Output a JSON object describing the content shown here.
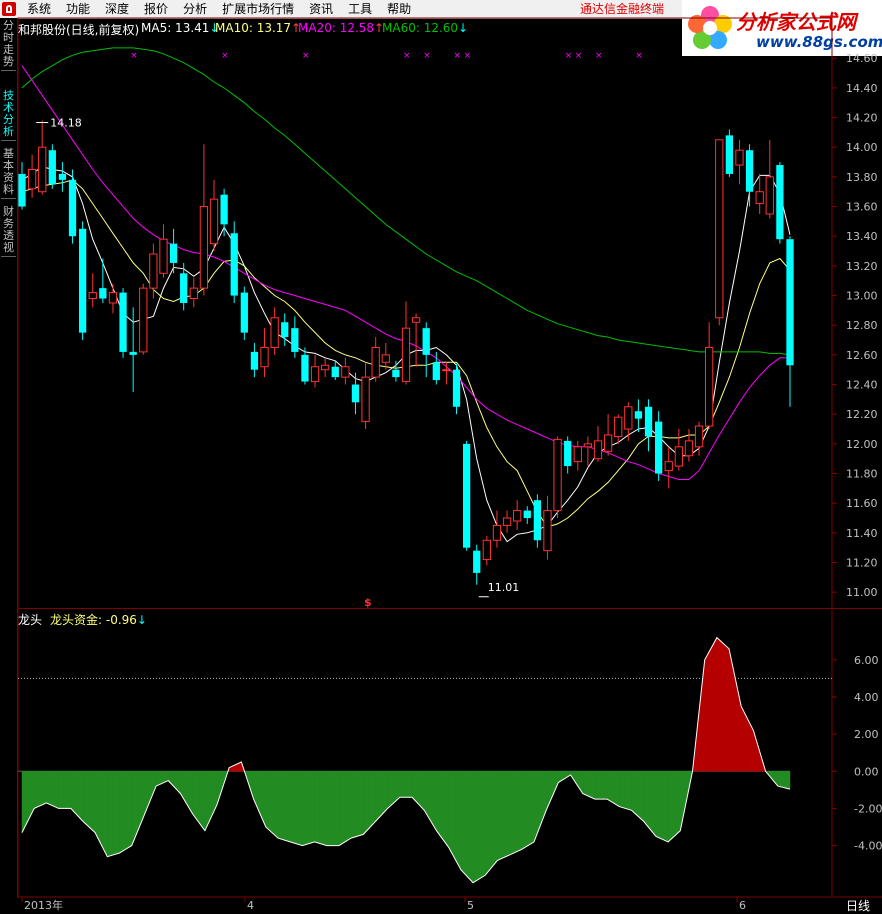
{
  "menu": [
    "系统",
    "功能",
    "深度",
    "报价",
    "分析",
    "扩展市场行情",
    "资讯",
    "工具",
    "帮助"
  ],
  "promo_text": "通达信金融终端",
  "watermark": {
    "title": "分析家公式网",
    "url": "www.88gs.com"
  },
  "side_tabs": [
    "分时走势",
    "技术分析",
    "基本资料",
    "财务透视"
  ],
  "header": {
    "stock": "和邦股份(日线,前复权)",
    "ma5": "MA5: 13.41",
    "ma10": "MA10: 13.17",
    "ma20": "MA20: 12.58",
    "ma60": "MA60: 12.60",
    "ma5_arrow": "↓",
    "ma10_arrow": "↑",
    "ma20_arrow": "↑",
    "ma60_arrow": "↓"
  },
  "indicator_header": {
    "name": "龙头",
    "label": "龙头资金: -0.96",
    "arrow": "↓"
  },
  "bottom": {
    "period": "日线"
  },
  "colors": {
    "up": "#ff3232",
    "down": "#00ffff",
    "ma5": "#ffffff",
    "ma10": "#ffff80",
    "ma20": "#ff00ff",
    "ma60": "#00c000",
    "pos_fill": "#b40000",
    "neg_fill": "#228b22",
    "frame": "#800000"
  },
  "chart_data": [
    {
      "type": "candlestick",
      "title": "和邦股份(日线,前复权)",
      "ylim": [
        10.9,
        14.75
      ],
      "y_ticks": [
        "14.60",
        "14.40",
        "14.20",
        "14.00",
        "13.80",
        "13.60",
        "13.40",
        "13.20",
        "13.00",
        "12.80",
        "12.60",
        "12.40",
        "12.20",
        "12.00",
        "11.80",
        "11.60",
        "11.40",
        "11.20",
        "11.00"
      ],
      "x_labels": [
        "2013年",
        "4",
        "5",
        "6"
      ],
      "annotations": {
        "high": "14.18",
        "low": "11.01",
        "marker": "$"
      },
      "candles": [
        [
          13.82,
          13.6,
          13.9,
          13.58
        ],
        [
          13.72,
          13.85,
          13.95,
          13.66
        ],
        [
          13.7,
          14.0,
          14.18,
          13.68
        ],
        [
          13.98,
          13.75,
          14.02,
          13.72
        ],
        [
          13.82,
          13.78,
          13.9,
          13.7
        ],
        [
          13.78,
          13.4,
          13.85,
          13.35
        ],
        [
          13.45,
          12.75,
          13.5,
          12.7
        ],
        [
          12.98,
          13.02,
          13.15,
          12.92
        ],
        [
          13.05,
          12.98,
          13.25,
          12.95
        ],
        [
          12.95,
          13.02,
          13.08,
          12.88
        ],
        [
          13.02,
          12.62,
          13.05,
          12.58
        ],
        [
          12.62,
          12.6,
          12.92,
          12.35
        ],
        [
          12.62,
          13.05,
          13.08,
          12.6
        ],
        [
          13.05,
          13.28,
          13.35,
          12.98
        ],
        [
          13.15,
          13.38,
          13.48,
          13.12
        ],
        [
          13.35,
          13.22,
          13.45,
          13.15
        ],
        [
          13.15,
          12.95,
          13.22,
          12.9
        ],
        [
          12.98,
          13.05,
          13.12,
          12.92
        ],
        [
          13.05,
          13.6,
          14.02,
          13.0
        ],
        [
          13.35,
          13.65,
          13.78,
          13.3
        ],
        [
          13.68,
          13.48,
          13.72,
          13.4
        ],
        [
          13.42,
          13.0,
          13.5,
          12.95
        ],
        [
          13.02,
          12.75,
          13.06,
          12.7
        ],
        [
          12.62,
          12.5,
          12.68,
          12.45
        ],
        [
          12.52,
          12.65,
          12.78,
          12.45
        ],
        [
          12.65,
          12.85,
          12.92,
          12.6
        ],
        [
          12.82,
          12.72,
          12.88,
          12.66
        ],
        [
          12.78,
          12.62,
          12.86,
          12.58
        ],
        [
          12.6,
          12.42,
          12.65,
          12.4
        ],
        [
          12.42,
          12.52,
          12.6,
          12.38
        ],
        [
          12.5,
          12.53,
          12.58,
          12.45
        ],
        [
          12.52,
          12.45,
          12.56,
          12.43
        ],
        [
          12.45,
          12.52,
          12.58,
          12.4
        ],
        [
          12.4,
          12.28,
          12.48,
          12.2
        ],
        [
          12.15,
          12.45,
          12.55,
          12.1
        ],
        [
          12.45,
          12.65,
          12.72,
          12.42
        ],
        [
          12.55,
          12.6,
          12.68,
          12.5
        ],
        [
          12.5,
          12.45,
          12.56,
          12.42
        ],
        [
          12.42,
          12.78,
          12.96,
          12.4
        ],
        [
          12.82,
          12.85,
          12.88,
          12.52
        ],
        [
          12.78,
          12.6,
          12.82,
          12.45
        ],
        [
          12.55,
          12.43,
          12.62,
          12.4
        ],
        [
          12.5,
          12.5,
          12.55,
          12.4
        ],
        [
          12.5,
          12.25,
          12.54,
          12.2
        ],
        [
          12.0,
          11.3,
          12.02,
          11.28
        ],
        [
          11.28,
          11.13,
          11.32,
          11.05
        ],
        [
          11.22,
          11.35,
          11.38,
          11.18
        ],
        [
          11.35,
          11.45,
          11.55,
          11.3
        ],
        [
          11.45,
          11.5,
          11.55,
          11.4
        ],
        [
          11.48,
          11.55,
          11.62,
          11.42
        ],
        [
          11.55,
          11.5,
          11.58,
          11.46
        ],
        [
          11.62,
          11.35,
          11.66,
          11.3
        ],
        [
          11.28,
          11.55,
          11.65,
          11.22
        ],
        [
          11.55,
          12.03,
          12.05,
          11.5
        ],
        [
          12.02,
          11.85,
          12.05,
          11.8
        ],
        [
          11.88,
          11.98,
          12.02,
          11.82
        ],
        [
          11.98,
          12.0,
          12.05,
          11.85
        ],
        [
          11.9,
          12.02,
          12.12,
          11.88
        ],
        [
          11.95,
          12.06,
          12.2,
          11.92
        ],
        [
          12.05,
          12.18,
          12.2,
          12.0
        ],
        [
          12.1,
          12.25,
          12.28,
          12.02
        ],
        [
          12.22,
          12.17,
          12.3,
          12.08
        ],
        [
          12.25,
          12.05,
          12.3,
          11.95
        ],
        [
          12.15,
          11.8,
          12.22,
          11.75
        ],
        [
          11.82,
          11.88,
          11.98,
          11.7
        ],
        [
          11.85,
          11.98,
          12.1,
          11.82
        ],
        [
          11.92,
          12.02,
          12.1,
          11.88
        ],
        [
          11.98,
          12.12,
          12.15,
          11.92
        ],
        [
          12.12,
          12.65,
          12.82,
          12.1
        ],
        [
          12.85,
          14.05,
          14.05,
          12.8
        ],
        [
          14.08,
          13.82,
          14.12,
          13.8
        ],
        [
          13.88,
          13.98,
          14.05,
          13.75
        ],
        [
          13.98,
          13.7,
          14.02,
          13.6
        ],
        [
          13.62,
          13.7,
          13.82,
          13.55
        ],
        [
          13.55,
          13.8,
          14.05,
          13.52
        ],
        [
          13.88,
          13.38,
          13.9,
          13.35
        ],
        [
          13.38,
          12.53,
          13.4,
          12.25
        ]
      ],
      "series": [
        {
          "name": "MA5",
          "values": [
            13.78,
            13.82,
            13.87,
            13.85,
            13.84,
            13.8,
            13.62,
            13.38,
            13.22,
            13.05,
            12.88,
            12.82,
            12.84,
            12.86,
            13.05,
            13.19,
            13.18,
            13.13,
            13.18,
            13.32,
            13.46,
            13.35,
            13.2,
            13.02,
            12.88,
            12.75,
            12.71,
            12.66,
            12.62,
            12.61,
            12.58,
            12.56,
            12.5,
            12.44,
            12.42,
            12.45,
            12.48,
            12.53,
            12.6,
            12.63,
            12.63,
            12.65,
            12.6,
            12.53,
            12.3,
            11.9,
            11.62,
            11.45,
            11.34,
            11.39,
            11.4,
            11.42,
            11.45,
            11.54,
            11.62,
            11.71,
            11.84,
            11.94,
            11.98,
            12.01,
            12.06,
            12.1,
            12.11,
            12.05,
            11.98,
            11.92,
            11.92,
            11.97,
            12.12,
            12.55,
            12.95,
            13.3,
            13.7,
            13.81,
            13.81,
            13.69,
            13.41
          ]
        },
        {
          "name": "MA10",
          "values": [
            13.7,
            13.72,
            13.74,
            13.75,
            13.76,
            13.78,
            13.72,
            13.62,
            13.52,
            13.42,
            13.32,
            13.22,
            13.15,
            13.04,
            12.98,
            12.96,
            12.99,
            13.0,
            13.05,
            13.15,
            13.23,
            13.24,
            13.2,
            13.12,
            13.06,
            13.0,
            12.96,
            12.9,
            12.82,
            12.75,
            12.68,
            12.63,
            12.6,
            12.58,
            12.55,
            12.53,
            12.52,
            12.51,
            12.52,
            12.53,
            12.53,
            12.55,
            12.55,
            12.55,
            12.46,
            12.28,
            12.11,
            11.98,
            11.88,
            11.82,
            11.68,
            11.54,
            11.44,
            11.46,
            11.5,
            11.56,
            11.63,
            11.68,
            11.74,
            11.82,
            11.9,
            12.0,
            12.05,
            12.05,
            12.04,
            12.04,
            12.06,
            12.06,
            12.12,
            12.28,
            12.45,
            12.65,
            12.88,
            13.08,
            13.22,
            13.25,
            13.17
          ]
        },
        {
          "name": "MA20",
          "values": [
            14.55,
            14.45,
            14.35,
            14.25,
            14.15,
            14.05,
            13.95,
            13.85,
            13.76,
            13.68,
            13.6,
            13.52,
            13.46,
            13.41,
            13.37,
            13.34,
            13.31,
            13.29,
            13.28,
            13.26,
            13.23,
            13.19,
            13.15,
            13.11,
            13.07,
            13.04,
            13.02,
            13.0,
            12.98,
            12.96,
            12.94,
            12.92,
            12.9,
            12.86,
            12.82,
            12.78,
            12.74,
            12.71,
            12.69,
            12.66,
            12.62,
            12.58,
            12.52,
            12.46,
            12.38,
            12.3,
            12.24,
            12.2,
            12.16,
            12.13,
            12.1,
            12.07,
            12.04,
            12.01,
            11.99,
            11.98,
            11.98,
            11.96,
            11.94,
            11.91,
            11.88,
            11.86,
            11.83,
            11.8,
            11.78,
            11.76,
            11.76,
            11.82,
            11.94,
            12.06,
            12.17,
            12.28,
            12.38,
            12.46,
            12.53,
            12.58,
            12.58
          ]
        },
        {
          "name": "MA60",
          "values": [
            14.4,
            14.46,
            14.51,
            14.55,
            14.59,
            14.62,
            14.64,
            14.65,
            14.66,
            14.67,
            14.67,
            14.67,
            14.66,
            14.65,
            14.63,
            14.6,
            14.57,
            14.53,
            14.49,
            14.44,
            14.4,
            14.35,
            14.3,
            14.24,
            14.19,
            14.13,
            14.08,
            14.02,
            13.96,
            13.9,
            13.84,
            13.78,
            13.72,
            13.66,
            13.6,
            13.54,
            13.48,
            13.43,
            13.38,
            13.33,
            13.28,
            13.24,
            13.2,
            13.16,
            13.13,
            13.1,
            13.06,
            13.02,
            12.98,
            12.94,
            12.9,
            12.87,
            12.84,
            12.81,
            12.79,
            12.77,
            12.75,
            12.73,
            12.72,
            12.7,
            12.69,
            12.68,
            12.67,
            12.66,
            12.65,
            12.64,
            12.63,
            12.62,
            12.62,
            12.62,
            12.62,
            12.62,
            12.62,
            12.62,
            12.61,
            12.61,
            12.6
          ]
        }
      ],
      "signal_markers": [
        11,
        20,
        28,
        38,
        40,
        43,
        44,
        54,
        55,
        57,
        61
      ]
    },
    {
      "type": "area",
      "title": "龙头资金",
      "ylim": [
        -6.5,
        7.5
      ],
      "y_ticks": [
        "6.00",
        "4.00",
        "2.00",
        "0.00",
        "-2.00",
        "-4.00"
      ],
      "dotted_level": 5.0,
      "values": [
        -3.3,
        -2.0,
        -1.7,
        -2.0,
        -2.0,
        -2.7,
        -3.3,
        -4.6,
        -4.4,
        -4.0,
        -2.4,
        -0.8,
        -0.5,
        -1.2,
        -2.3,
        -3.2,
        -1.8,
        0.2,
        0.5,
        -1.5,
        -3.0,
        -3.6,
        -3.8,
        -4.0,
        -3.8,
        -4.0,
        -4.0,
        -3.6,
        -3.4,
        -2.7,
        -2.0,
        -1.4,
        -1.4,
        -2.1,
        -3.2,
        -4.1,
        -5.3,
        -6.0,
        -5.6,
        -4.8,
        -4.5,
        -4.2,
        -3.8,
        -2.1,
        -0.6,
        -0.2,
        -1.2,
        -1.5,
        -1.5,
        -1.9,
        -2.1,
        -2.7,
        -3.5,
        -3.8,
        -3.2,
        0.0,
        6.0,
        7.2,
        6.6,
        3.5,
        2.2,
        0.0,
        -0.8,
        -0.96
      ]
    }
  ]
}
